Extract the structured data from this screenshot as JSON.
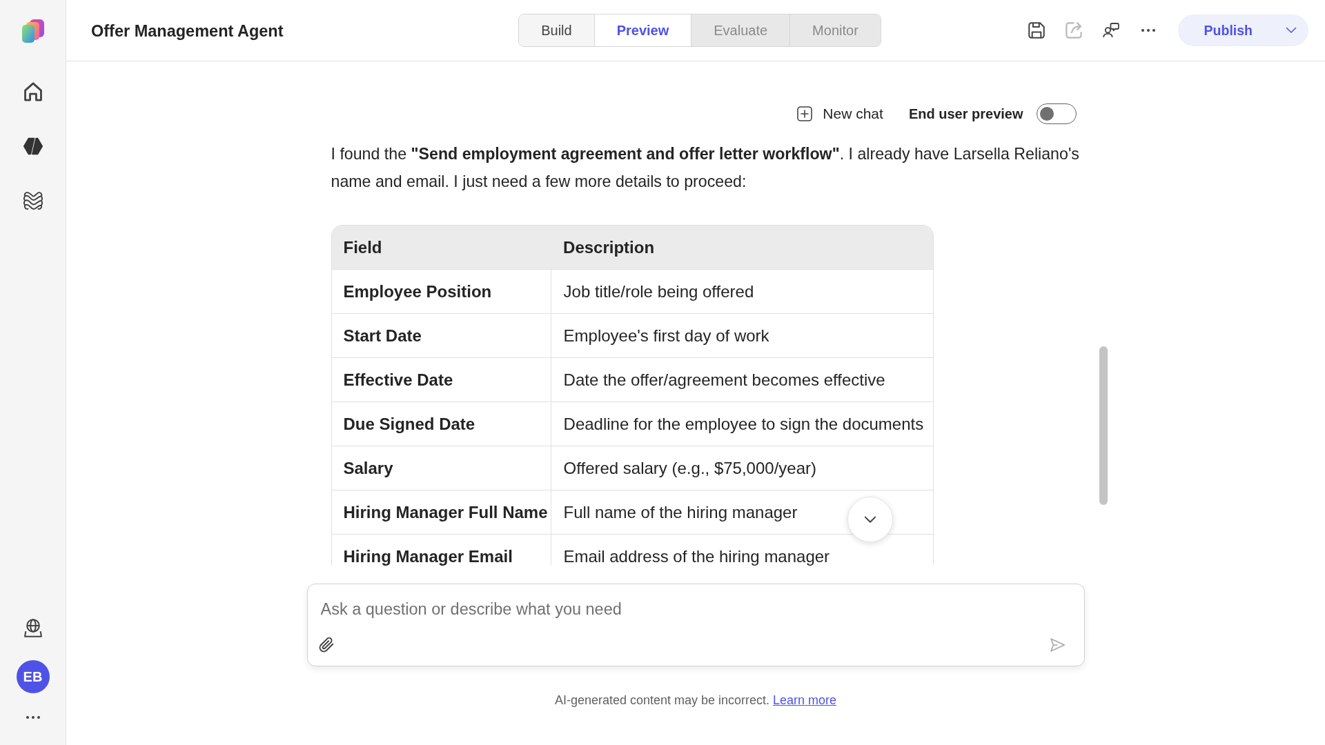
{
  "sidebar": {
    "avatar": {
      "initials": "EB"
    }
  },
  "header": {
    "title": "Offer Management Agent",
    "tabs": [
      {
        "label": "Build",
        "selected": false,
        "disabled": false
      },
      {
        "label": "Preview",
        "selected": true,
        "disabled": false
      },
      {
        "label": "Evaluate",
        "selected": false,
        "disabled": true
      },
      {
        "label": "Monitor",
        "selected": false,
        "disabled": true
      }
    ],
    "toolbar": [
      {
        "kind": "save",
        "disabled": false
      },
      {
        "kind": "share",
        "disabled": true
      },
      {
        "kind": "chat",
        "disabled": false
      },
      {
        "kind": "more",
        "disabled": false
      }
    ],
    "publish_button": {
      "label": "Publish"
    }
  },
  "chat": {
    "new_chat": {
      "label": "New chat"
    },
    "end_user_preview": {
      "label": "End user preview",
      "on": false
    },
    "message": "I found the **\"Send employment agreement and offer letter workflow\"**. I already have Larsella Reliano's name and email. I just need a few more details to proceed:",
    "table": {
      "columns": [
        "Field",
        "Description"
      ],
      "rows": [
        {
          "field": "Employee Position",
          "description": "Job title/role being offered"
        },
        {
          "field": "Start Date",
          "description": "Employee's first day of work"
        },
        {
          "field": "Effective Date",
          "description": "Date the offer/agreement becomes effective"
        },
        {
          "field": "Due Signed Date",
          "description": "Deadline for the employee to sign the documents"
        },
        {
          "field": "Salary",
          "description": "Offered salary (e.g., $75,000/year)"
        },
        {
          "field": "Hiring Manager Full Name",
          "description": "Full name of the hiring manager"
        },
        {
          "field": "Hiring Manager Email",
          "description": "Email address of the hiring manager"
        }
      ]
    }
  },
  "composer": {
    "placeholder": "Ask a question or describe what you need",
    "send_disabled": true
  },
  "footer": {
    "notice": "AI-generated content may be incorrect.",
    "link": "Learn more"
  }
}
